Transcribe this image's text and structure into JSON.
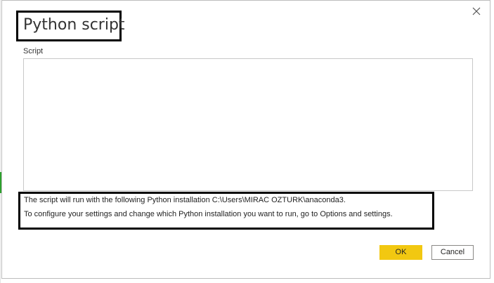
{
  "dialog": {
    "title": "Python script",
    "close_icon": "close-icon"
  },
  "script": {
    "label": "Script",
    "value": ""
  },
  "info": {
    "line1": "The script will run with the following Python installation C:\\Users\\MIRAC OZTURK\\anaconda3.",
    "line2": "To configure your settings and change which Python installation you want to run, go to Options and settings."
  },
  "buttons": {
    "ok_label": "OK",
    "cancel_label": "Cancel"
  },
  "colors": {
    "ok_button": "#f2c811",
    "annotation_border": "#000000"
  }
}
